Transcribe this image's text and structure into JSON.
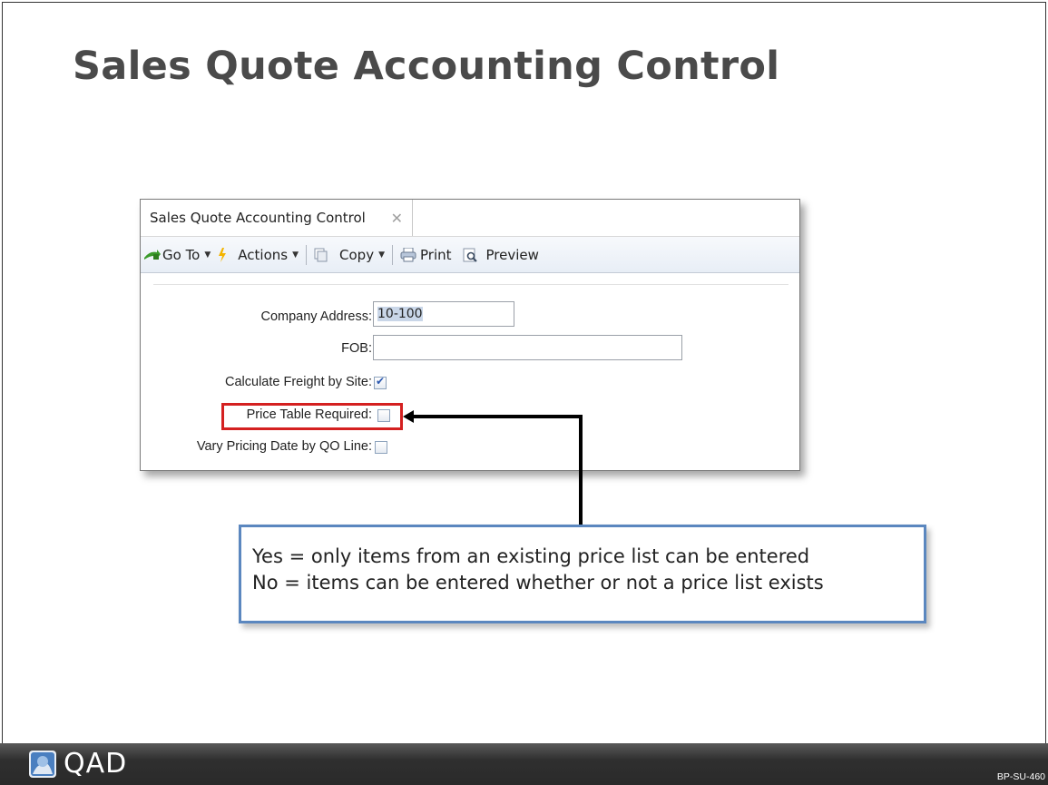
{
  "slide": {
    "title": "Sales Quote Accounting Control",
    "code": "BP-SU-460"
  },
  "window": {
    "tab_label": "Sales Quote Accounting Control",
    "tab_close": "✕",
    "toolbar": {
      "goto_label": "Go To",
      "actions_label": "Actions",
      "copy_label": "Copy",
      "print_label": "Print",
      "preview_label": "Preview",
      "caret": "▼"
    },
    "form": {
      "company_address_label": "Company Address:",
      "company_address_value": "10-100",
      "fob_label": "FOB:",
      "fob_value": "",
      "calc_freight_label": "Calculate Freight by Site:",
      "calc_freight_checked": true,
      "price_table_label": "Price Table Required:",
      "price_table_checked": false,
      "vary_pricing_label": "Vary Pricing Date by QO Line:",
      "vary_pricing_checked": false
    }
  },
  "callout": {
    "line1": "Yes = only items from an existing price list can be entered",
    "line2": "No = items can be entered whether or not a price list exists"
  },
  "footer": {
    "logo_text": "QAD"
  },
  "colors": {
    "highlight": "#d42020",
    "callout_border": "#5b87bf",
    "title": "#4a4a4a",
    "footer": "#2f2f2f"
  }
}
